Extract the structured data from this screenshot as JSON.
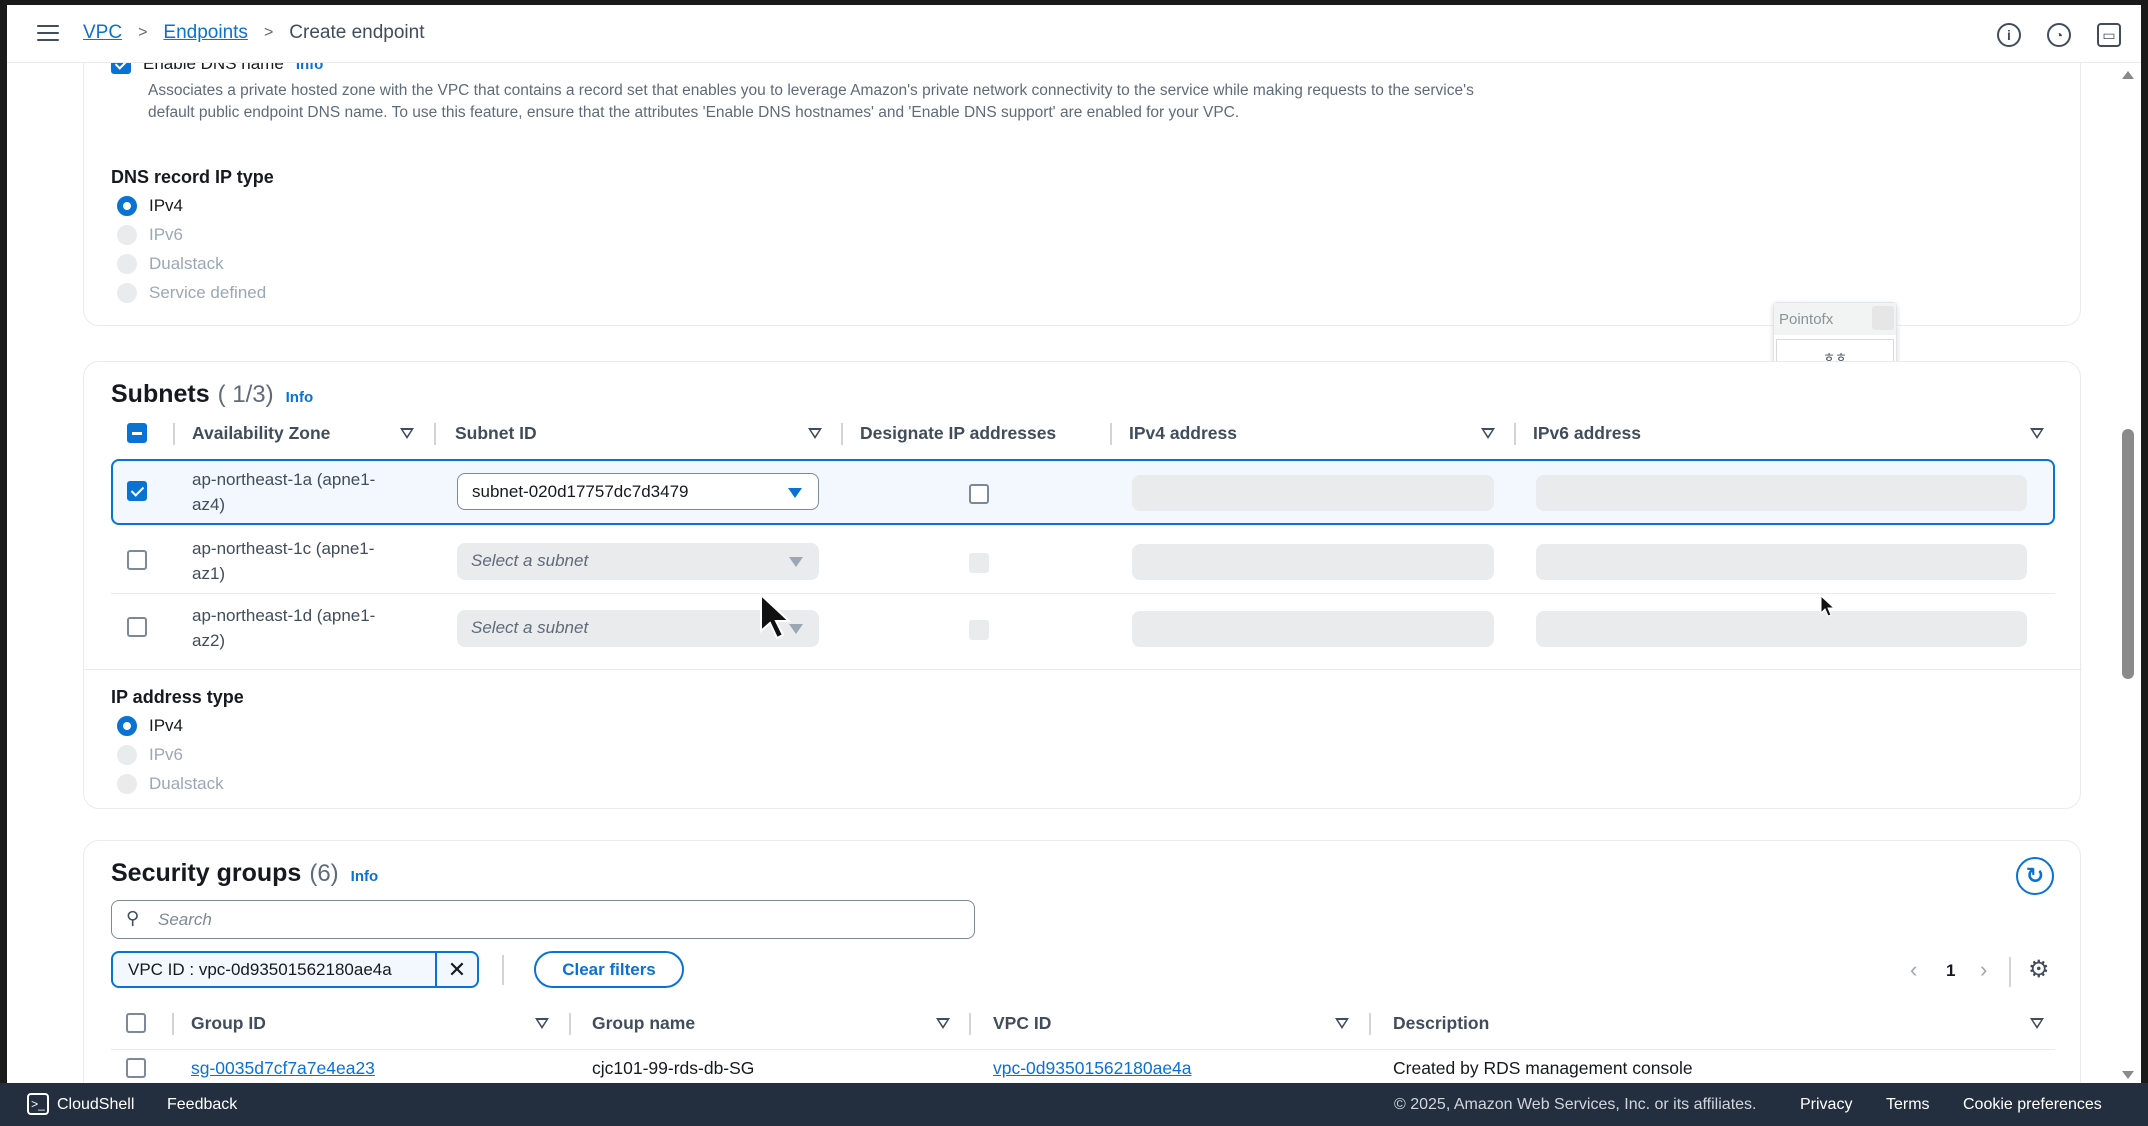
{
  "breadcrumb": {
    "items": [
      {
        "label": "VPC"
      },
      {
        "label": "Endpoints"
      },
      {
        "label": "Create endpoint"
      }
    ],
    "separator": ">"
  },
  "top_icons": [
    "info-icon",
    "clock-icon",
    "monitor-icon"
  ],
  "private_dns": {
    "label": "Enable DNS name",
    "info": "Info",
    "description": "Associates a private hosted zone with the VPC that contains a record set that enables you to leverage Amazon's private network connectivity to the service while making requests to the service's default public endpoint DNS name. To use this feature, ensure that the attributes 'Enable DNS hostnames' and 'Enable DNS support' are enabled for your VPC."
  },
  "dns_record_ip_type": {
    "label": "DNS record IP type",
    "options": [
      {
        "label": "IPv4",
        "selected": true,
        "disabled": false
      },
      {
        "label": "IPv6",
        "selected": false,
        "disabled": true
      },
      {
        "label": "Dualstack",
        "selected": false,
        "disabled": true
      },
      {
        "label": "Service defined",
        "selected": false,
        "disabled": true
      }
    ]
  },
  "popup": {
    "title": "Pointofx",
    "button": "ㅎㅎ"
  },
  "subnets": {
    "title": "Subnets",
    "count": "( 1/3)",
    "info": "Info",
    "columns": [
      "Availability Zone",
      "Subnet ID",
      "Designate IP addresses",
      "IPv4 address",
      "IPv6 address"
    ],
    "rows": [
      {
        "az_line1": "ap-northeast-1a (apne1-",
        "az_line2": "az4)",
        "checked": true,
        "subnet": "subnet-020d17757dc7d3479",
        "subnet_placeholder": false
      },
      {
        "az_line1": "ap-northeast-1c (apne1-",
        "az_line2": "az1)",
        "checked": false,
        "subnet": "Select a subnet",
        "subnet_placeholder": true
      },
      {
        "az_line1": "ap-northeast-1d (apne1-",
        "az_line2": "az2)",
        "checked": false,
        "subnet": "Select a subnet",
        "subnet_placeholder": true
      }
    ]
  },
  "ip_address_type": {
    "label": "IP address type",
    "options": [
      {
        "label": "IPv4",
        "selected": true,
        "disabled": false
      },
      {
        "label": "IPv6",
        "selected": false,
        "disabled": true
      },
      {
        "label": "Dualstack",
        "selected": false,
        "disabled": true
      }
    ]
  },
  "security_groups": {
    "title": "Security groups",
    "count": "(6)",
    "info": "Info",
    "search_placeholder": "Search",
    "filter_token": "VPC ID : vpc-0d93501562180ae4a",
    "clear_filters": "Clear filters",
    "page": "1",
    "columns": [
      "Group ID",
      "Group name",
      "VPC ID",
      "Description"
    ],
    "rows": [
      {
        "group_id": "sg-0035d7cf7a7e4ea23",
        "group_name": "cjc101-99-rds-db-SG",
        "vpc_id": "vpc-0d93501562180ae4a",
        "description": "Created by RDS management console"
      }
    ]
  },
  "footer": {
    "cloudshell": "CloudShell",
    "feedback": "Feedback",
    "copyright": "© 2025, Amazon Web Services, Inc. or its affiliates.",
    "privacy": "Privacy",
    "terms": "Terms",
    "cookie": "Cookie preferences"
  },
  "colors": {
    "accent": "#0972d3",
    "footer_bg": "#232f3e",
    "disabled_bg": "#e9ebed"
  }
}
